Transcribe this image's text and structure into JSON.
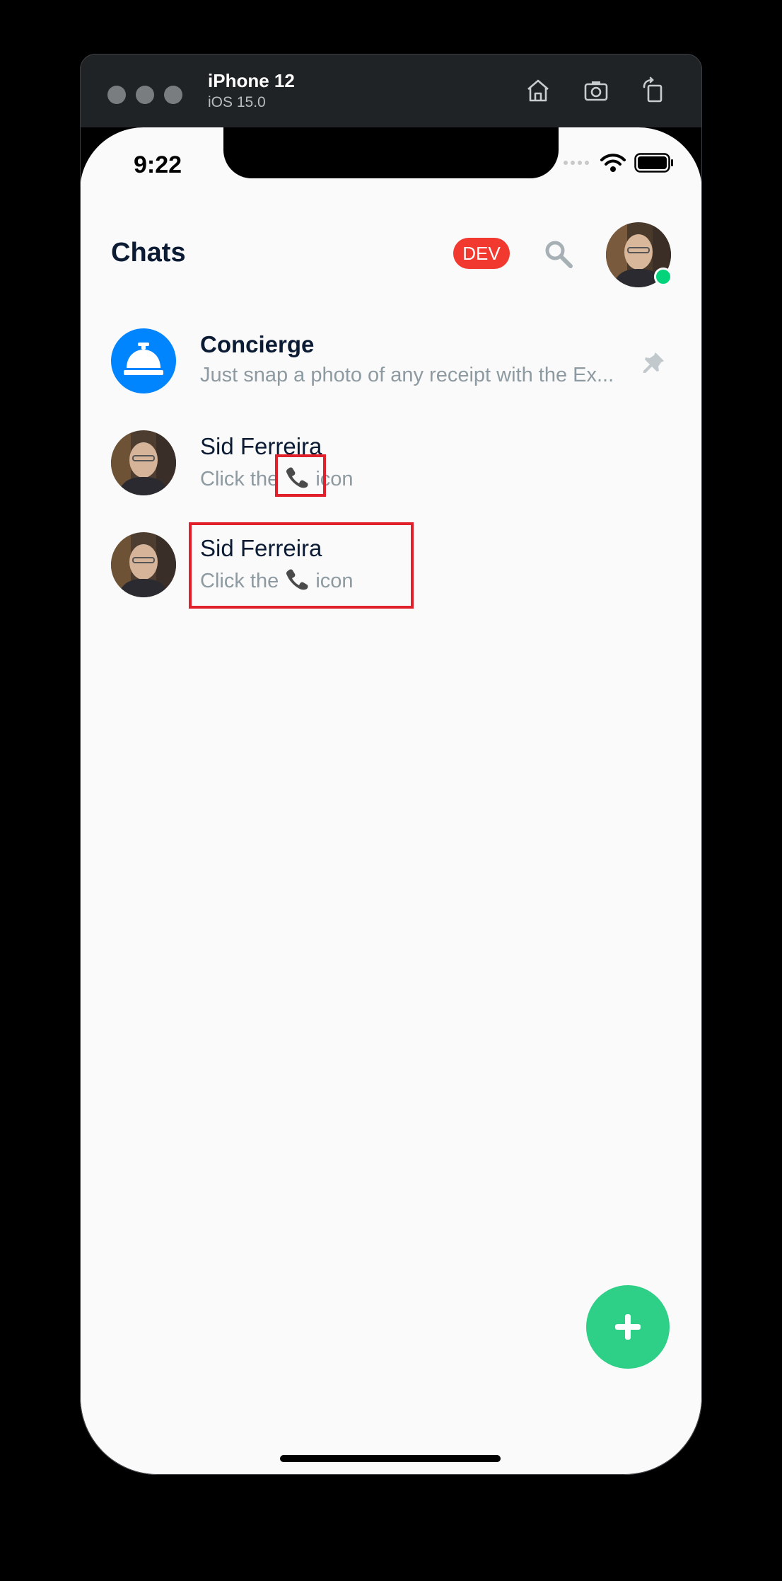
{
  "simulator": {
    "device_name": "iPhone 12",
    "os_version": "iOS 15.0",
    "toolbar_icons": [
      "home-icon",
      "screenshot-icon",
      "rotate-icon"
    ]
  },
  "status_bar": {
    "time": "9:22"
  },
  "header": {
    "title": "Chats",
    "dev_badge": "DEV"
  },
  "chats": [
    {
      "name": "Concierge",
      "preview": "Just snap a photo of any receipt with the Ex...",
      "pinned": true
    },
    {
      "name": "Sid Ferreira",
      "preview_before": "Click the ",
      "preview_after": " icon"
    },
    {
      "name": "Sid Ferreira",
      "preview_before": "Click the ",
      "preview_after": " icon"
    }
  ],
  "colors": {
    "accent_blue": "#0185ff",
    "fab_green": "#2ecf86",
    "dev_red": "#f2392f",
    "online_green": "#03d47c",
    "highlight_red": "#e0202a"
  }
}
